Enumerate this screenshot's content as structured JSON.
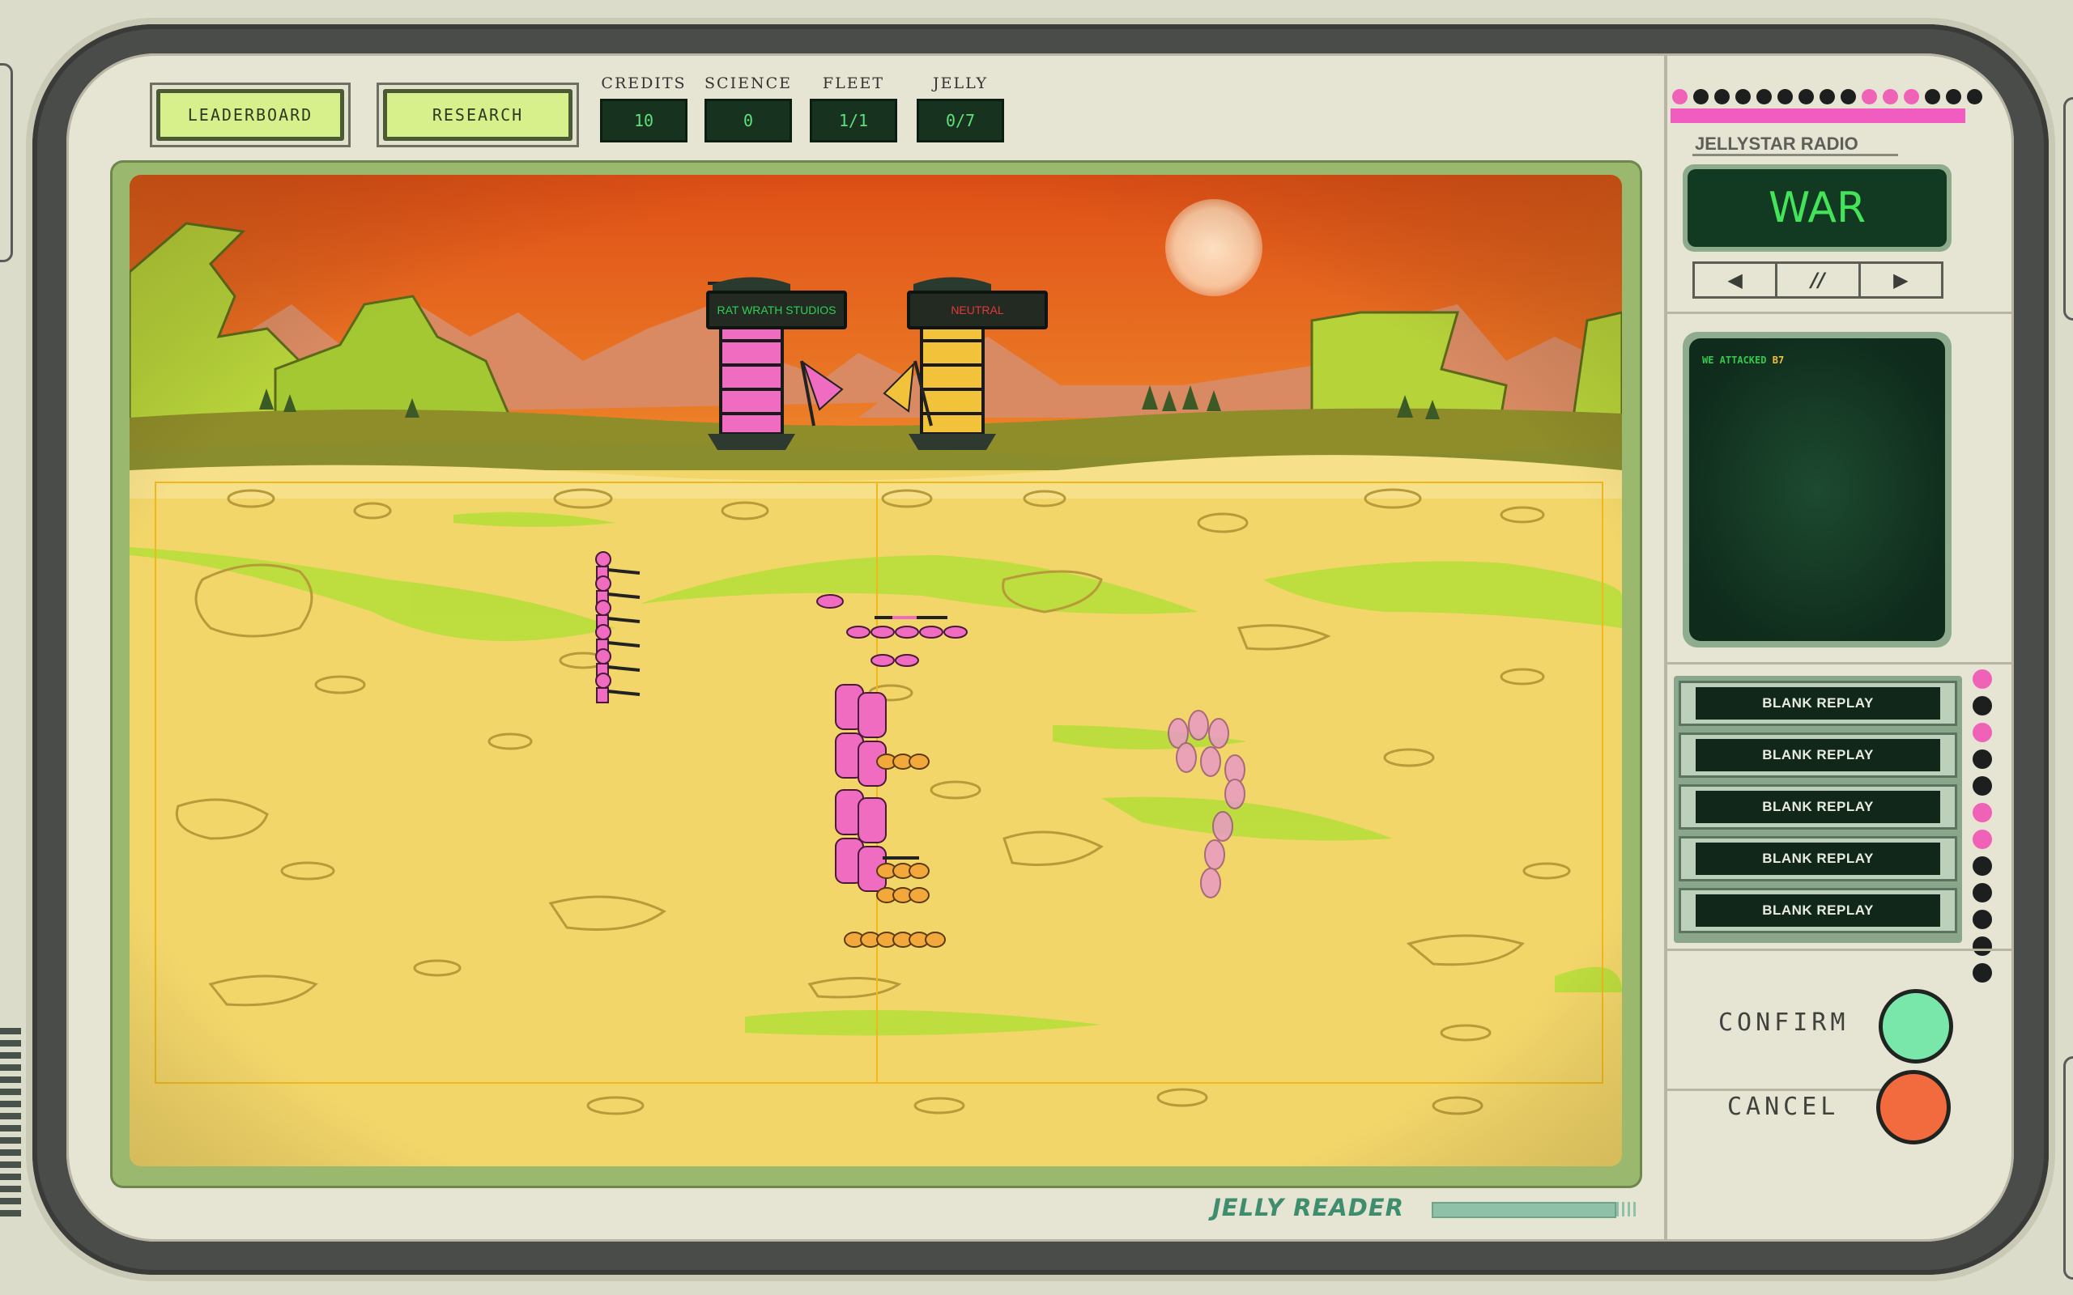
{
  "topbar": {
    "leaderboard_label": "LEADERBOARD",
    "research_label": "RESEARCH",
    "stats": [
      {
        "label": "CREDITS",
        "value": "10"
      },
      {
        "label": "SCIENCE",
        "value": "0"
      },
      {
        "label": "FLEET",
        "value": "1/1"
      },
      {
        "label": "JELLY",
        "value": "0/7"
      }
    ]
  },
  "battlefield": {
    "towers": [
      {
        "owner": "RAT WRATH STUDIOS",
        "color": "#f06cc0",
        "label_color": "#2fcf55"
      },
      {
        "owner": "NEUTRAL",
        "color": "#f2c23a",
        "label_color": "#e03a3a"
      }
    ],
    "sky_color": "#e05f1c",
    "ground_color": "#f3d56a"
  },
  "brand": {
    "name": "JELLY READER"
  },
  "radio": {
    "title": "JELLYSTAR RADIO",
    "station": "WAR",
    "controls": [
      "prev-icon",
      "pause-icon",
      "next-icon"
    ]
  },
  "log": {
    "lines": [
      {
        "text": "WE ATTACKED",
        "target": "B7"
      }
    ]
  },
  "replays": [
    "BLANK REPLAY",
    "BLANK REPLAY",
    "BLANK REPLAY",
    "BLANK REPLAY",
    "BLANK REPLAY"
  ],
  "actions": {
    "confirm_label": "CONFIRM",
    "cancel_label": "CANCEL",
    "confirm_color": "#79e7aa",
    "cancel_color": "#f26b3e"
  },
  "indicators": {
    "top_dots": [
      "pink",
      "dark",
      "dark",
      "dark",
      "dark",
      "dark",
      "dark",
      "dark",
      "dark",
      "pink",
      "pink",
      "pink",
      "dark",
      "dark",
      "dark"
    ],
    "side_dots": [
      "pink",
      "dark",
      "pink",
      "dark",
      "dark",
      "pink",
      "pink",
      "dark",
      "dark",
      "dark",
      "dark",
      "dark"
    ]
  }
}
